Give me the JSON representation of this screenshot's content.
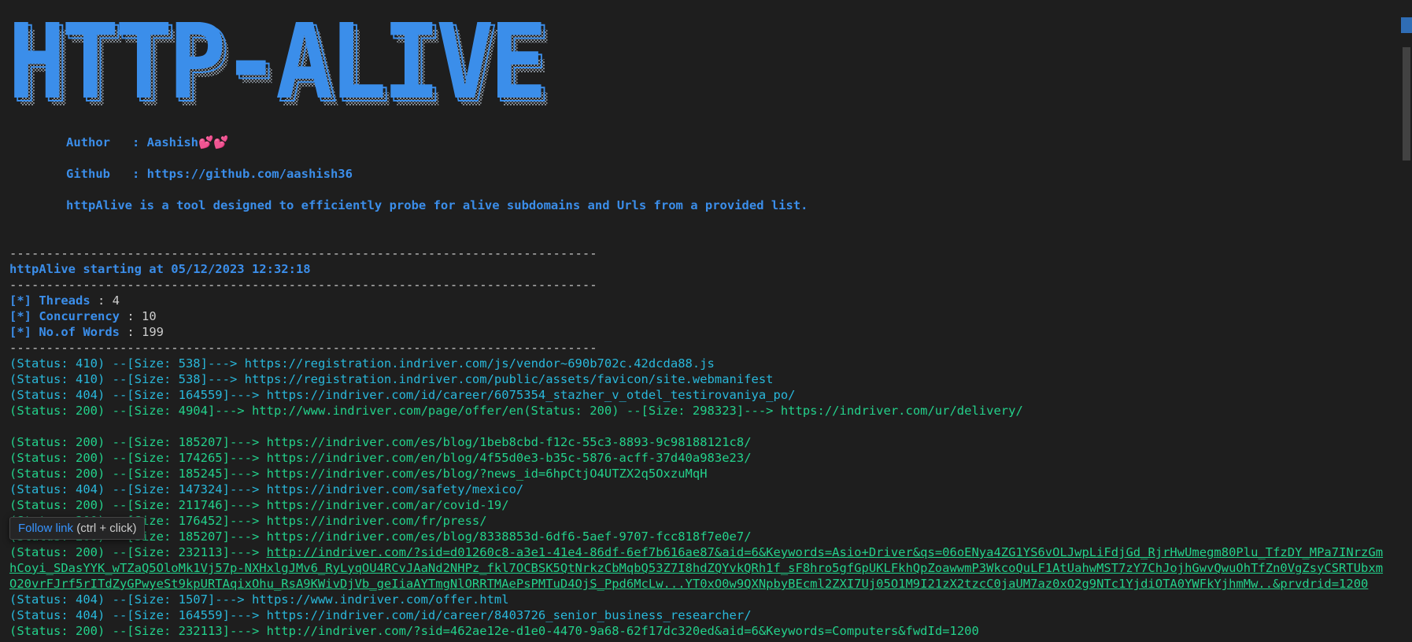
{
  "banner": {
    "text": "HTTP-ALIVE"
  },
  "info": {
    "author_label": "Author   : ",
    "author": "Aashish💕💕",
    "github_label": "Github   : ",
    "github": "https://github.com/aashish36",
    "description": "httpAlive is a tool designed to efficiently probe for alive subdomains and Urls from a provided list."
  },
  "separator": "--------------------------------------------------------------------------------",
  "start": "httpAlive starting at 05/12/2023 12:32:18",
  "params": [
    {
      "tag": "[*]",
      "label": "Threads",
      "value": " : 4"
    },
    {
      "tag": "[*]",
      "label": "Concurrency",
      "value": " : 10"
    },
    {
      "tag": "[*]",
      "label": "No.of Words",
      "value": " : 199"
    }
  ],
  "results": [
    {
      "prefix": "(Status: 410) --[Size: 538]---> ",
      "url": "https://registration.indriver.com/js/vendor~690b702c.42dcda88.js",
      "color": "#29b8db"
    },
    {
      "prefix": "(Status: 410) --[Size: 538]---> ",
      "url": "https://registration.indriver.com/public/assets/favicon/site.webmanifest",
      "color": "#29b8db"
    },
    {
      "prefix": "(Status: 404) --[Size: 164559]---> ",
      "url": "https://indriver.com/id/career/6075354_stazher_v_otdel_testirovaniya_po/",
      "color": "#29b8db"
    },
    {
      "prefix": "(Status: 200) --[Size: 4904]---> ",
      "url": "http://www.indriver.com/page/offer/en(Status: 200) --[Size: 298323]---> https://indriver.com/ur/delivery/",
      "color": "#23d18b"
    },
    {
      "prefix": "",
      "url": "",
      "color": "#23d18b"
    },
    {
      "prefix": "(Status: 200) --[Size: 185207]---> ",
      "url": "https://indriver.com/es/blog/1beb8cbd-f12c-55c3-8893-9c98188121c8/",
      "color": "#23d18b"
    },
    {
      "prefix": "(Status: 200) --[Size: 174265]---> ",
      "url": "https://indriver.com/en/blog/4f55d0e3-b35c-5876-acff-37d40a983e23/",
      "color": "#23d18b"
    },
    {
      "prefix": "(Status: 200) --[Size: 185245]---> ",
      "url": "https://indriver.com/es/blog/?news_id=6hpCtjO4UTZX2q5OxzuMqH",
      "color": "#23d18b"
    },
    {
      "prefix": "(Status: 404) --[Size: 147324]---> ",
      "url": "https://indriver.com/safety/mexico/",
      "color": "#29b8db"
    },
    {
      "prefix": "(Status: 200) --[Size: 211746]---> ",
      "url": "https://indriver.com/ar/covid-19/",
      "color": "#23d18b"
    },
    {
      "prefix": "(Status: 200) --[Size: 176452]---> ",
      "url": "https://indriver.com/fr/press/",
      "color": "#23d18b"
    },
    {
      "prefix": "(Status: 200) --[Size: 185207]---> ",
      "url": "https://indriver.com/es/blog/8338853d-6df6-5aef-9707-fcc818f7e0e7/",
      "color": "#23d18b"
    }
  ],
  "long_result": {
    "prefix": "(Status: 200) --[Size: 232113]---> ",
    "url": "http://indriver.com/?sid=d01260c8-a3e1-41e4-86df-6ef7b616ae87&aid=6&Keywords=Asio+Driver&qs=06oENya4ZG1YS6vOLJwpLiFdjGd_RjrHwUmegm80Plu_TfzDY_MPa7INrzGmhCoyi_SDasYYK_wTZaQ5OloMk1Vj57p-NXHxlgJMv6_RyLyqOU4RCvJAaNd2NHPz_fkl7OCBSK5QtNrkzCbMqbQ53Z7I8hdZQYvkQRh1f_sF8hro5gfGpUKLFkhQpZoawwmP3WkcoQuLF1AtUahwMST7zY7ChJojhGwvQwuOhTfZn0VgZsyCSRTUbxmO20vrFJrf5rITdZyGPwyeSt9kpURTAqixOhu_RsA9KWivDjVb_geIiaAYTmgNlORRTMAePsPMTuD4OjS_Ppd6McLw...YT0xO0w9QXNpbyBEcml2ZXI7Uj05O1M9I21zX2tzcC0jaUM7az0xO2g9NTc1YjdiOTA0YWFkYjhmMw..&prvdrid=1200"
  },
  "more_results": [
    {
      "prefix": "(Status: 404) --[Size: 1507]---> ",
      "url": "https://www.indriver.com/offer.html",
      "color": "#29b8db"
    },
    {
      "prefix": "(Status: 404) --[Size: 164559]---> ",
      "url": "https://indriver.com/id/career/8403726_senior_business_researcher/",
      "color": "#29b8db"
    },
    {
      "prefix": "(Status: 200) --[Size: 232113]---> ",
      "url": "http://indriver.com/?sid=462ae12e-d1e0-4470-9a68-62f17dc320ed&aid=6&Keywords=Computers&fwdId=1200",
      "color": "#23d18b"
    }
  ],
  "tooltip": {
    "link": "Follow link",
    "hint": " (ctrl + click)"
  },
  "colors": {
    "background": "#1e1e1e",
    "blue": "#3b8eea",
    "green": "#23d18b",
    "teal": "#29b8db"
  }
}
